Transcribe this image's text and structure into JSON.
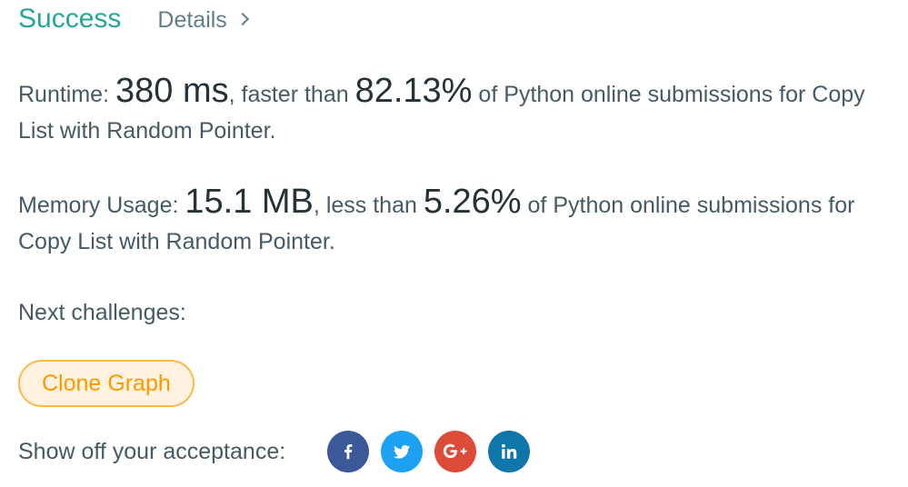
{
  "header": {
    "status": "Success",
    "details_label": "Details"
  },
  "runtime": {
    "label": "Runtime: ",
    "value": "380 ms",
    "mid": ", faster than ",
    "percent": "82.13%",
    "suffix": " of Python online submissions for Copy List with Random Pointer."
  },
  "memory": {
    "label": "Memory Usage: ",
    "value": "15.1 MB",
    "mid": ", less than ",
    "percent": "5.26%",
    "suffix": " of Python online submissions for Copy List with Random Pointer."
  },
  "next": {
    "label": "Next challenges:",
    "challenges": [
      "Clone Graph"
    ]
  },
  "share": {
    "label": "Show off your acceptance:",
    "icons": [
      {
        "name": "facebook-icon",
        "color": "#3b5998"
      },
      {
        "name": "twitter-icon",
        "color": "#1da1f2"
      },
      {
        "name": "google-plus-icon",
        "color": "#dd4b39"
      },
      {
        "name": "linkedin-icon",
        "color": "#0e76a8"
      }
    ]
  }
}
